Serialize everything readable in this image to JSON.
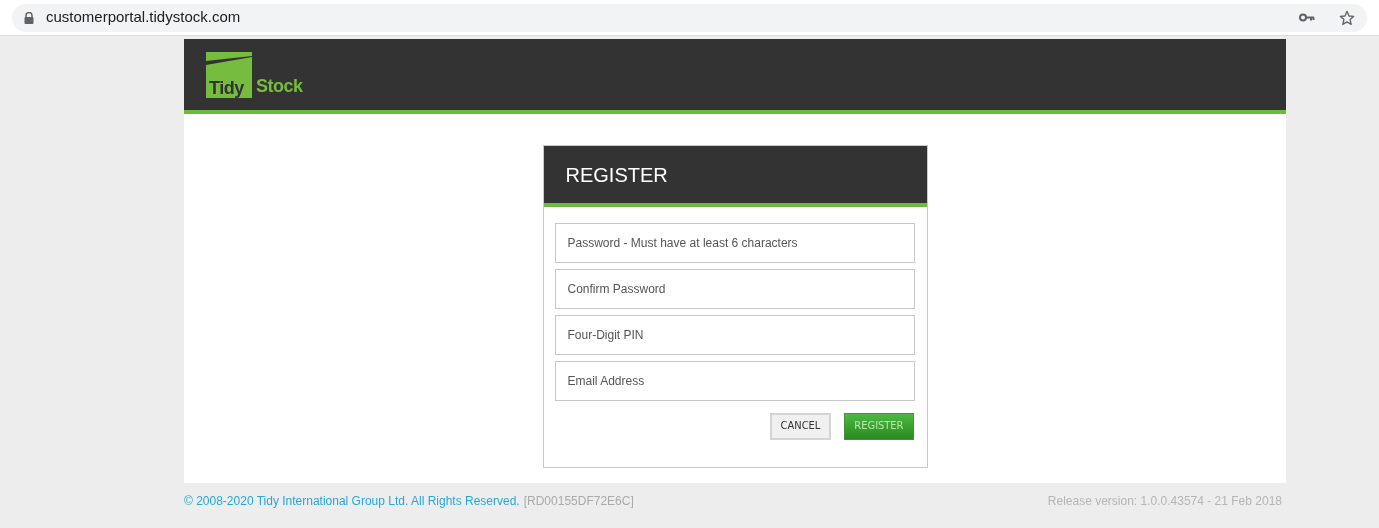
{
  "browser": {
    "url": "customerportal.tidystock.com"
  },
  "logo": {
    "word_1": "Tidy",
    "word_2": "Stock"
  },
  "register_card": {
    "title": "REGISTER",
    "fields": [
      {
        "placeholder": "Password - Must have at least 6 characters"
      },
      {
        "placeholder": "Confirm Password"
      },
      {
        "placeholder": "Four-Digit PIN"
      },
      {
        "placeholder": "Email Address"
      }
    ],
    "buttons": [
      {
        "label": "CANCEL",
        "kind": "secondary"
      },
      {
        "label": "REGISTER",
        "kind": "primary"
      }
    ]
  },
  "footer": {
    "copyright": "© 2008-2020 Tidy International Group Ltd. All Rights Reserved.",
    "build_id": "[RD00155DF72E6C]",
    "release": "Release version: 1.0.0.43574 - 21 Feb 2018"
  }
}
